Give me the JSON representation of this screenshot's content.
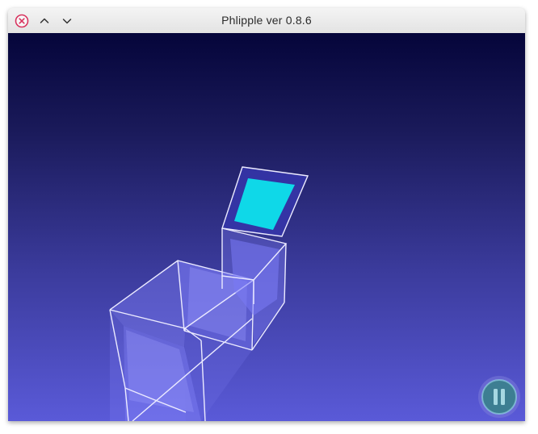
{
  "window": {
    "title": "Phlipple ver 0.8.6",
    "controls": {
      "close_icon": "close-icon",
      "minimize_icon": "chevron-up-icon",
      "maximize_icon": "chevron-down-icon"
    }
  },
  "game": {
    "pause_icon": "pause-icon",
    "colors": {
      "background_top": "#05053a",
      "background_bottom": "#5a5ad8",
      "wireframe": "#e8e8ff",
      "translucent_face": "#8a8aff",
      "active_tile": "#0fd8e8",
      "pause_button": "#4a8a9a"
    }
  }
}
